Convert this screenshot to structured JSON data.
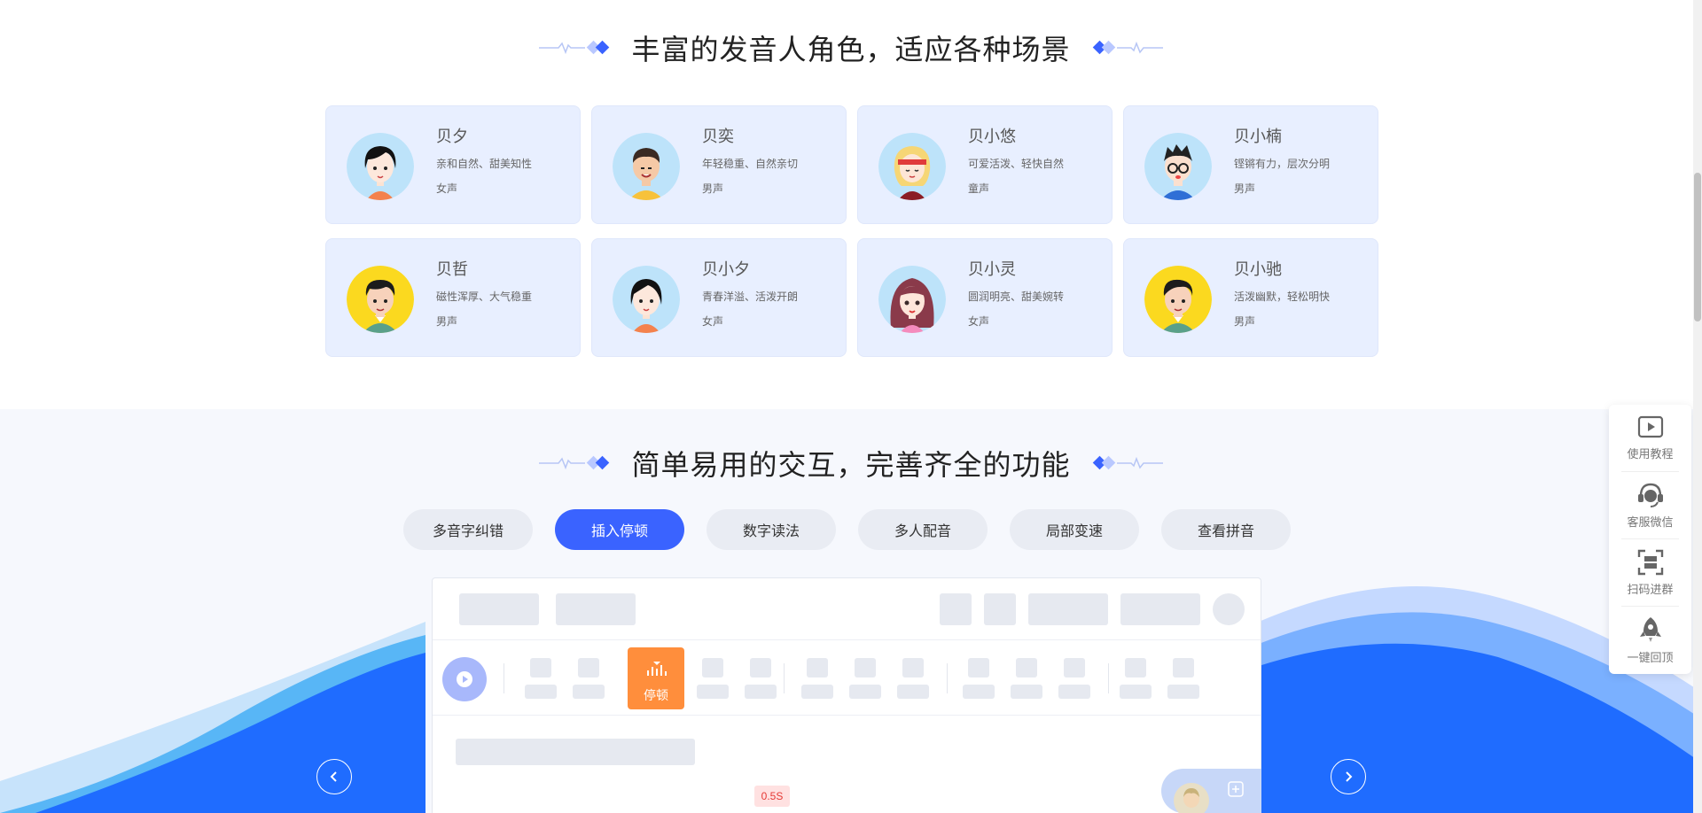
{
  "section1": {
    "title": "丰富的发音人角色，适应各种场景"
  },
  "voices": [
    {
      "name": "贝夕",
      "desc": "亲和自然、甜美知性",
      "gender": "女声",
      "avatar": "female-short-hair-icon"
    },
    {
      "name": "贝奕",
      "desc": "年轻稳重、自然亲切",
      "gender": "男声",
      "avatar": "male-smiling-icon"
    },
    {
      "name": "贝小悠",
      "desc": "可爱活泼、轻快自然",
      "gender": "童声",
      "avatar": "blonde-girl-icon"
    },
    {
      "name": "贝小楠",
      "desc": "铿锵有力，层次分明",
      "gender": "男声",
      "avatar": "male-glasses-icon"
    },
    {
      "name": "贝哲",
      "desc": "磁性浑厚、大气稳重",
      "gender": "男声",
      "avatar": "male-yellow-bg-icon"
    },
    {
      "name": "贝小夕",
      "desc": "青春洋溢、活泼开朗",
      "gender": "女声",
      "avatar": "female-short-hair-icon"
    },
    {
      "name": "贝小灵",
      "desc": "圆润明亮、甜美婉转",
      "gender": "女声",
      "avatar": "female-long-hair-icon"
    },
    {
      "name": "贝小驰",
      "desc": "活泼幽默，轻松明快",
      "gender": "男声",
      "avatar": "male-yellow-bg-icon"
    }
  ],
  "section2": {
    "title": "简单易用的交互，完善齐全的功能"
  },
  "feature_tabs": [
    {
      "label": "多音字纠错",
      "active": false
    },
    {
      "label": "插入停顿",
      "active": true
    },
    {
      "label": "数字读法",
      "active": false
    },
    {
      "label": "多人配音",
      "active": false
    },
    {
      "label": "局部变速",
      "active": false
    },
    {
      "label": "查看拼音",
      "active": false
    }
  ],
  "demo": {
    "pause_label": "停顿",
    "time_tag": "0.5S"
  },
  "side_panel": [
    {
      "label": "使用教程",
      "icon": "video-tutorial-icon"
    },
    {
      "label": "客服微信",
      "icon": "customer-service-icon"
    },
    {
      "label": "扫码进群",
      "icon": "scan-qr-icon"
    },
    {
      "label": "一键回顶",
      "icon": "rocket-top-icon"
    }
  ],
  "colors": {
    "accent": "#3a63ff",
    "card_bg": "#e8efff",
    "pause_orange": "#ff8e3c",
    "wave_blue": "#1f6cff"
  }
}
